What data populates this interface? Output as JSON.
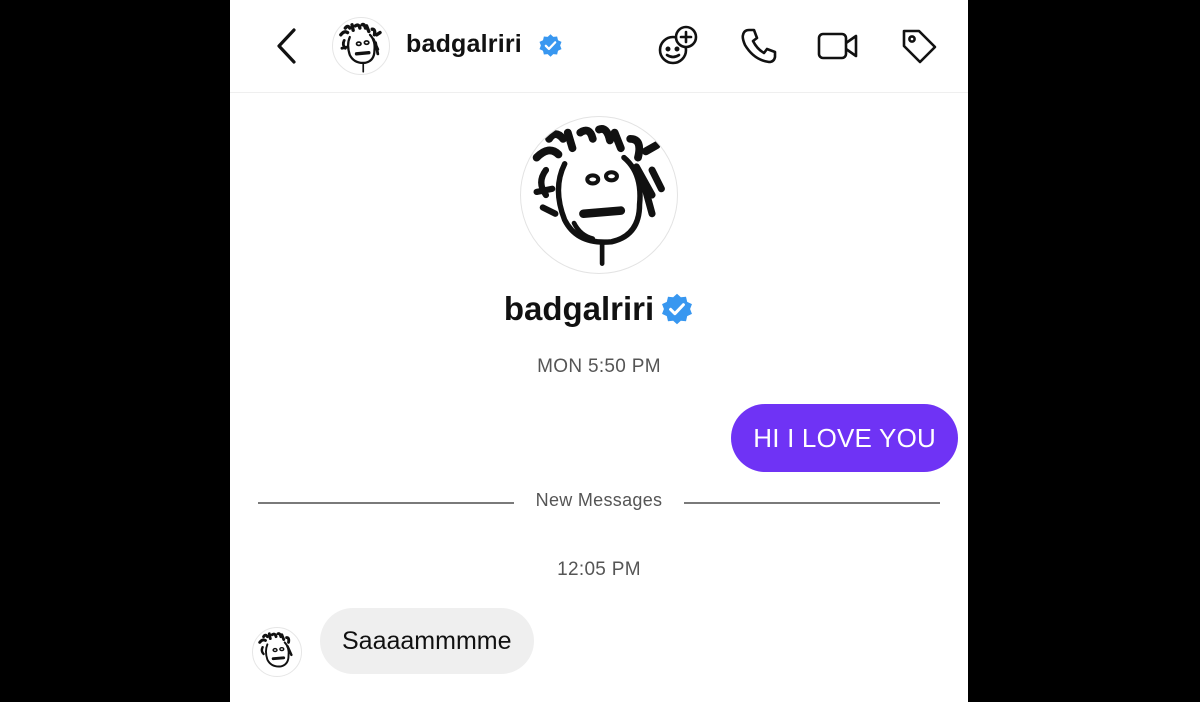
{
  "header": {
    "username": "badgalriri",
    "verified": true
  },
  "icons": {
    "back": "chevron-left-icon",
    "effects": "sticker-plus-icon",
    "call": "phone-icon",
    "video": "video-camera-icon",
    "tag": "tag-icon",
    "verified": "verified-badge-icon"
  },
  "profile": {
    "username": "badgalriri"
  },
  "thread": {
    "first_timestamp": "MON 5:50 PM",
    "outgoing_message": "HI I LOVE YOU",
    "new_messages_label": "New Messages",
    "second_timestamp": "12:05 PM",
    "incoming_message": "Saaaammmme"
  },
  "colors": {
    "outgoing_bubble": "#6f33f5",
    "incoming_bubble": "#efefef",
    "verified_badge": "#3897f0",
    "side_background": "#000000"
  }
}
